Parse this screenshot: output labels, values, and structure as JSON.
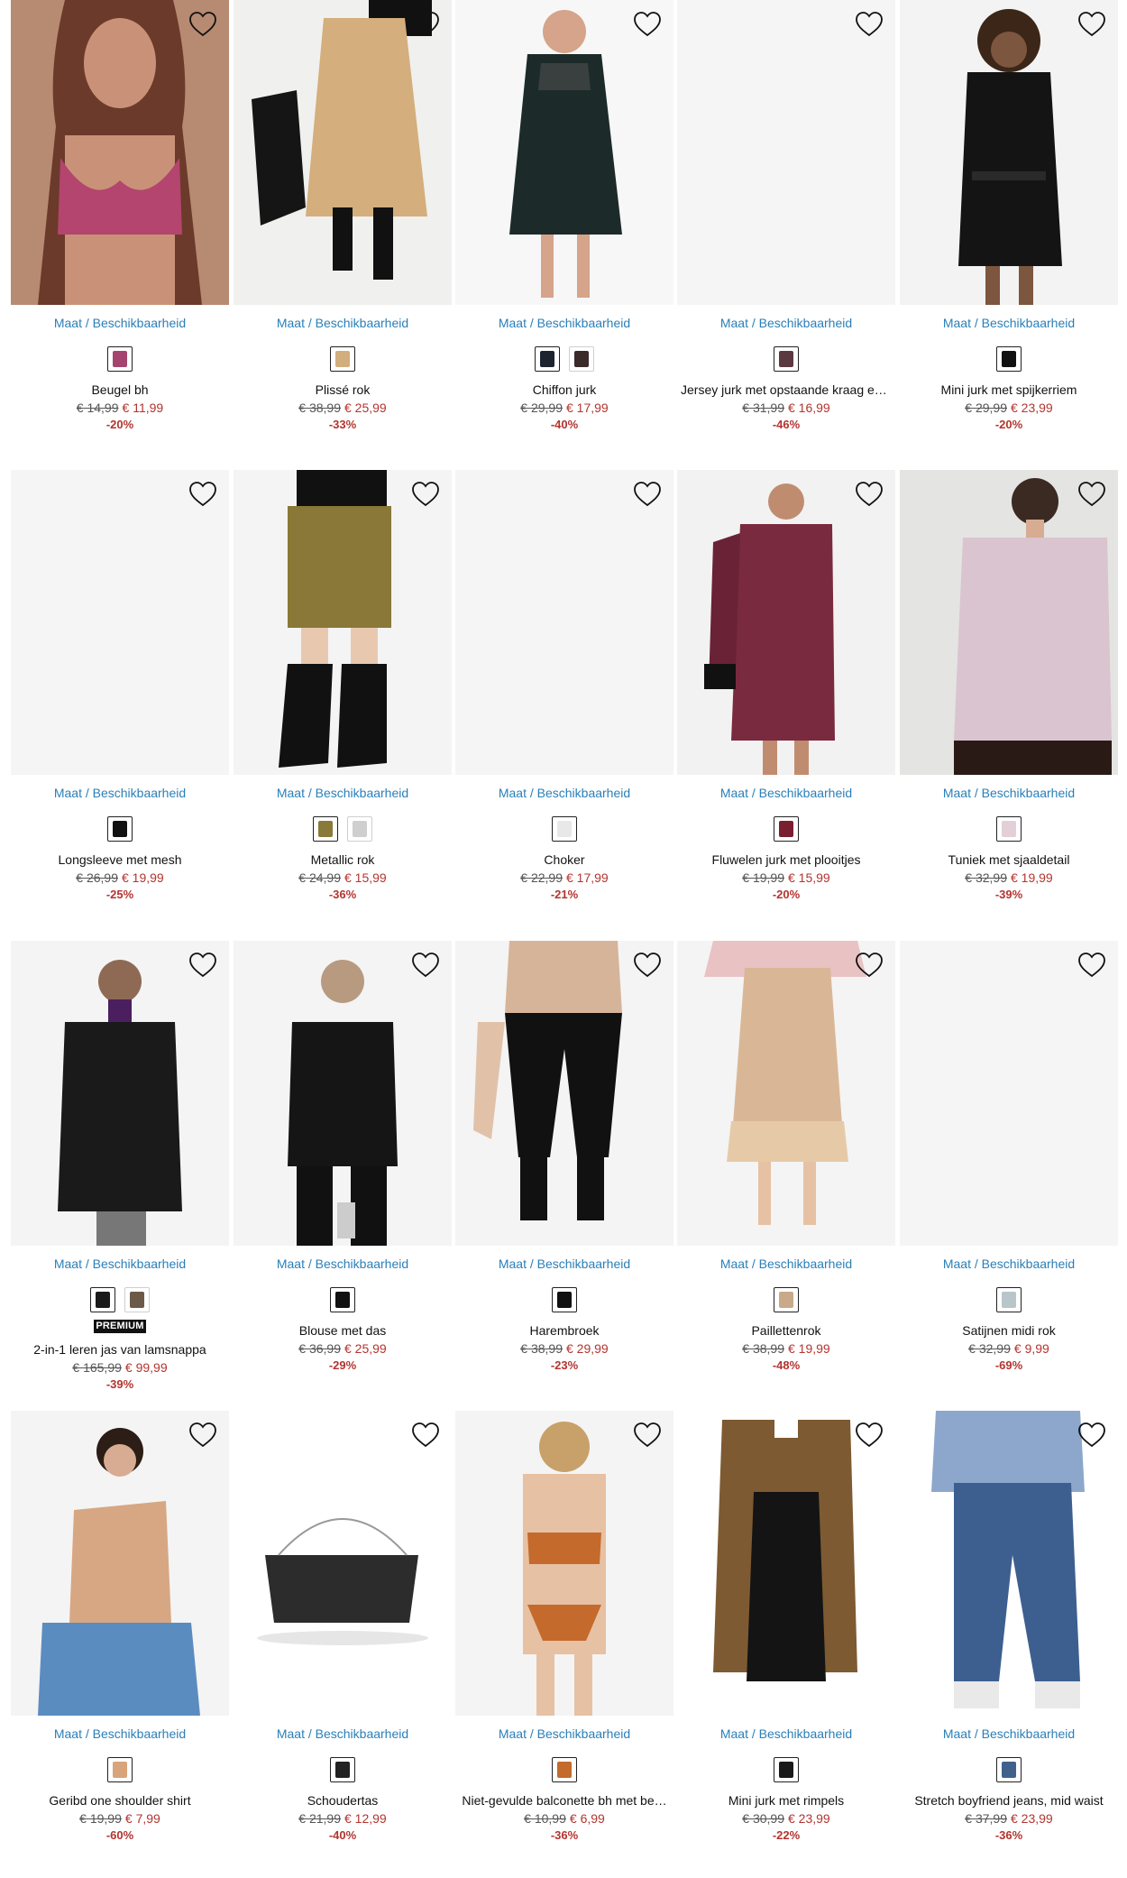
{
  "sizes_label": "Maat / Beschikbaarheid",
  "favorite_icon": "heart-outline-icon",
  "colors": {
    "price_sale": "#b3342f",
    "link": "#2a7fb8"
  },
  "products": [
    {
      "name": "Beugel bh",
      "old_price": "€ 14,99",
      "new_price": "€ 11,99",
      "discount": "-20%",
      "swatches": [
        "#a5456f"
      ],
      "image": "bra-pink"
    },
    {
      "name": "Plissé rok",
      "old_price": "€ 38,99",
      "new_price": "€ 25,99",
      "discount": "-33%",
      "swatches": [
        "#d2ad7d"
      ],
      "image": "skirt-beige"
    },
    {
      "name": "Chiffon jurk",
      "old_price": "€ 29,99",
      "new_price": "€ 17,99",
      "discount": "-40%",
      "swatches": [
        "#1d2430",
        "#3a2a2a"
      ],
      "image": "dress-floral"
    },
    {
      "name": "Jersey jurk met opstaande kraag en…",
      "old_price": "€ 31,99",
      "new_price": "€ 16,99",
      "discount": "-46%",
      "swatches": [
        "#5a3a40"
      ],
      "image": "blank"
    },
    {
      "name": "Mini jurk met spijkerriem",
      "old_price": "€ 29,99",
      "new_price": "€ 23,99",
      "discount": "-20%",
      "swatches": [
        "#111111"
      ],
      "image": "dress-black"
    },
    {
      "name": "Longsleeve met mesh",
      "old_price": "€ 26,99",
      "new_price": "€ 19,99",
      "discount": "-25%",
      "swatches": [
        "#111111"
      ],
      "image": "blank"
    },
    {
      "name": "Metallic rok",
      "old_price": "€ 24,99",
      "new_price": "€ 15,99",
      "discount": "-36%",
      "swatches": [
        "#8a7a3a",
        "#cfcfcf"
      ],
      "image": "skirt-gold"
    },
    {
      "name": "Choker",
      "old_price": "€ 22,99",
      "new_price": "€ 17,99",
      "discount": "-21%",
      "swatches": [
        "#e8e8e8"
      ],
      "image": "blank"
    },
    {
      "name": "Fluwelen jurk met plooitjes",
      "old_price": "€ 19,99",
      "new_price": "€ 15,99",
      "discount": "-20%",
      "swatches": [
        "#7a1f30"
      ],
      "image": "dress-velvet"
    },
    {
      "name": "Tuniek met sjaaldetail",
      "old_price": "€ 32,99",
      "new_price": "€ 19,99",
      "discount": "-39%",
      "swatches": [
        "#e2cfd8"
      ],
      "image": "blouse-lilac"
    },
    {
      "name": "2-in-1 leren jas van lamsnappa",
      "old_price": "€ 165,99",
      "new_price": "€ 99,99",
      "discount": "-39%",
      "swatches": [
        "#1a1a1a",
        "#6b5a47"
      ],
      "badge": "PREMIUM",
      "image": "coat-leather"
    },
    {
      "name": "Blouse met das",
      "old_price": "€ 36,99",
      "new_price": "€ 25,99",
      "discount": "-29%",
      "swatches": [
        "#111111"
      ],
      "image": "blouse-black"
    },
    {
      "name": "Harembroek",
      "old_price": "€ 38,99",
      "new_price": "€ 29,99",
      "discount": "-23%",
      "swatches": [
        "#111111"
      ],
      "image": "pants-black"
    },
    {
      "name": "Paillettenrok",
      "old_price": "€ 38,99",
      "new_price": "€ 19,99",
      "discount": "-48%",
      "swatches": [
        "#c9a98a"
      ],
      "image": "skirt-sequin"
    },
    {
      "name": "Satijnen midi rok",
      "old_price": "€ 32,99",
      "new_price": "€ 9,99",
      "discount": "-69%",
      "swatches": [
        "#b8c6c9"
      ],
      "image": "blank"
    },
    {
      "name": "Geribd one shoulder shirt",
      "old_price": "€ 19,99",
      "new_price": "€ 7,99",
      "discount": "-60%",
      "swatches": [
        "#d9a47a"
      ],
      "image": "shirt-beige"
    },
    {
      "name": "Schoudertas",
      "old_price": "€ 21,99",
      "new_price": "€ 12,99",
      "discount": "-40%",
      "swatches": [
        "#222222"
      ],
      "image": "bag-glitter"
    },
    {
      "name": "Niet-gevulde balconette bh met be…",
      "old_price": "€ 10,99",
      "new_price": "€ 6,99",
      "discount": "-36%",
      "swatches": [
        "#c46a2c"
      ],
      "image": "lingerie-orange"
    },
    {
      "name": "Mini jurk met rimpels",
      "old_price": "€ 30,99",
      "new_price": "€ 23,99",
      "discount": "-22%",
      "swatches": [
        "#1a1a1a"
      ],
      "image": "dress-leopard"
    },
    {
      "name": "Stretch boyfriend jeans, mid waist",
      "old_price": "€ 37,99",
      "new_price": "€ 23,99",
      "discount": "-36%",
      "swatches": [
        "#41618d"
      ],
      "image": "jeans-blue"
    }
  ]
}
